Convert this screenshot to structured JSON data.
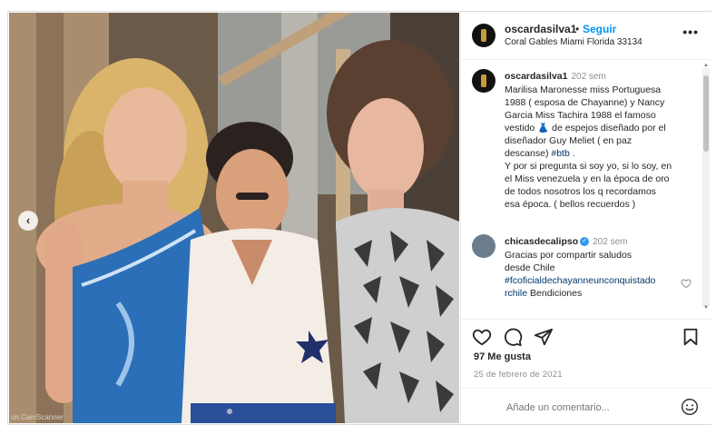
{
  "post": {
    "username": "oscardasilva1",
    "separator": "•",
    "follow_label": "Seguir",
    "location": "Coral Gables Miami Florida 33134",
    "more_label": "•••"
  },
  "caption": {
    "username": "oscardasilva1",
    "time": "202 sem",
    "lines": [
      "Marilisa Maronesse miss Portuguesa",
      "1988 ( esposa de Chayanne) y Nancy",
      "Garcia Miss Tachira 1988 el famoso",
      "vestido 👗 de espejos diseñado por el",
      "diseñador Guy Meliet ( en paz",
      "descanse) ",
      "Y por si pregunta si soy yo, si lo soy, en",
      "el Miss venezuela y en la época de oro",
      "de todos nosotros los q recordamos",
      "esa época. ( bellos recuerdos )"
    ],
    "hashtag": "#btb",
    "hashtag_suffix": " ."
  },
  "comment": {
    "username": "chicasdecalipso",
    "verified": "✓",
    "time": "202 sem",
    "lines": [
      "Gracias por compartir saludos",
      "desde Chile"
    ],
    "hashtag_line1": "#fcoficialdechayanneunconquistado",
    "hashtag_line2": "rchile",
    "suffix": " Bendiciones"
  },
  "footer": {
    "likes": "97 Me gusta",
    "date": "25 de febrero de 2021",
    "comment_placeholder": "Añade un comentario..."
  },
  "photo": {
    "watermark": "on CamScanner",
    "prev_label": "‹"
  }
}
